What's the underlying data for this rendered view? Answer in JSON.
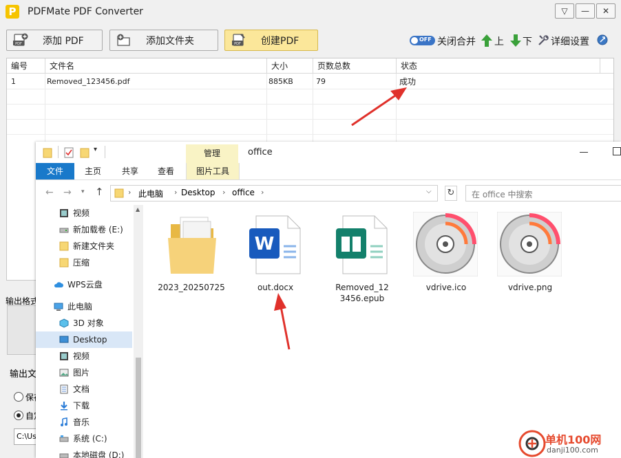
{
  "app": {
    "title": "PDFMate PDF Converter",
    "logo_letter": "P",
    "window_buttons": [
      "▽",
      "—",
      "✕"
    ]
  },
  "toolbar": {
    "add_pdf": "添加 PDF",
    "add_folder": "添加文件夹",
    "create_pdf": "创建PDF",
    "toggle_state": "OFF",
    "merge_label": "关闭合并",
    "up_label": "上",
    "down_label": "下",
    "settings_label": "详细设置"
  },
  "table": {
    "headers": [
      "编号",
      "文件名",
      "大小",
      "页数总数",
      "状态"
    ],
    "rows": [
      {
        "num": "1",
        "name": "Removed_123456.pdf",
        "size": "885KB",
        "pages": "79",
        "status": "成功"
      }
    ]
  },
  "left_panel": {
    "output_format_partial": "输出格式",
    "output_folder_partial": "输出文",
    "radio1_partial": "保存",
    "radio2_partial": "自定",
    "path_partial": "C:\\Us"
  },
  "explorer": {
    "title": "office",
    "manage_tab": "管理",
    "tabs": [
      "文件",
      "主页",
      "共享",
      "查看",
      "图片工具"
    ],
    "breadcrumb": [
      "此电脑",
      "Desktop",
      "office"
    ],
    "search_placeholder": "在 office 中搜索",
    "nav_items": [
      {
        "label": "视频",
        "icon": "video-icon"
      },
      {
        "label": "新加载卷 (E:)",
        "icon": "drive-icon"
      },
      {
        "label": "新建文件夹",
        "icon": "folder-icon"
      },
      {
        "label": "压缩",
        "icon": "folder-icon"
      },
      {
        "label": "WPS云盘",
        "icon": "cloud-icon"
      },
      {
        "label": "此电脑",
        "icon": "computer-icon"
      },
      {
        "label": "3D 对象",
        "icon": "3d-objects-icon"
      },
      {
        "label": "Desktop",
        "icon": "desktop-icon"
      },
      {
        "label": "视频",
        "icon": "video-icon"
      },
      {
        "label": "图片",
        "icon": "picture-icon"
      },
      {
        "label": "文档",
        "icon": "document-icon"
      },
      {
        "label": "下载",
        "icon": "download-icon"
      },
      {
        "label": "音乐",
        "icon": "music-icon"
      },
      {
        "label": "系统 (C:)",
        "icon": "drive-icon"
      },
      {
        "label": "本地磁盘 (D:)",
        "icon": "drive-icon"
      }
    ],
    "files": [
      {
        "name": "2023_20250725",
        "type": "folder"
      },
      {
        "name": "out.docx",
        "type": "word"
      },
      {
        "name": "Removed_123456.epub",
        "type": "epub"
      },
      {
        "name": "vdrive.ico",
        "type": "disc"
      },
      {
        "name": "vdrive.png",
        "type": "disc"
      }
    ]
  },
  "watermark": {
    "site_name": "单机100网",
    "site_url": "danji100.com"
  },
  "colors": {
    "accent": "#1979ca",
    "annotation_red": "#e0312b",
    "create_button": "#fbe79a",
    "manage_tab": "#f9f3c5"
  }
}
